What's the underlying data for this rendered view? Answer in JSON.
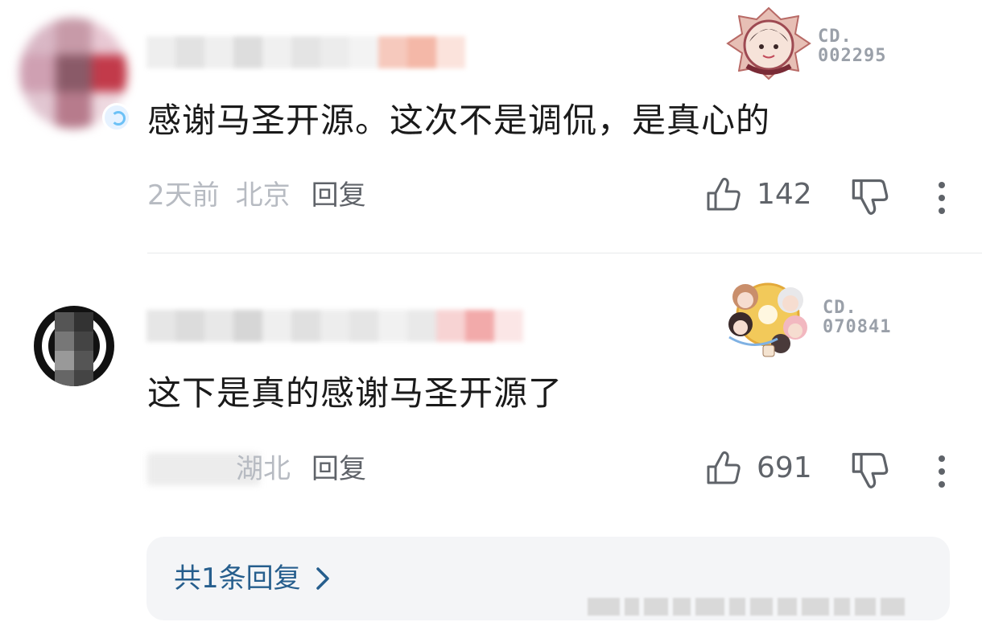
{
  "comments": [
    {
      "text": "感谢马圣开源。这次不是调侃，是真心的",
      "time": "2天前",
      "location": "北京",
      "reply_label": "回复",
      "likes": "142",
      "fan_badge_code": "CD.\n002295"
    },
    {
      "text": "这下是真的感谢马圣开源了",
      "location": "湖北",
      "reply_label": "回复",
      "likes": "691",
      "fan_badge_code": "CD.\n070841"
    }
  ],
  "replies": {
    "label": "共1条回复"
  },
  "colors": {
    "text": "#1a1a1a",
    "meta": "#b7bbc2",
    "action": "#5f6369",
    "link": "#265e8d",
    "reply_box_bg": "#f4f5f7"
  },
  "icons": [
    "thumbs-up-icon",
    "thumbs-down-icon",
    "more-vertical-icon",
    "chevron-right-icon",
    "verified-badge-icon"
  ]
}
